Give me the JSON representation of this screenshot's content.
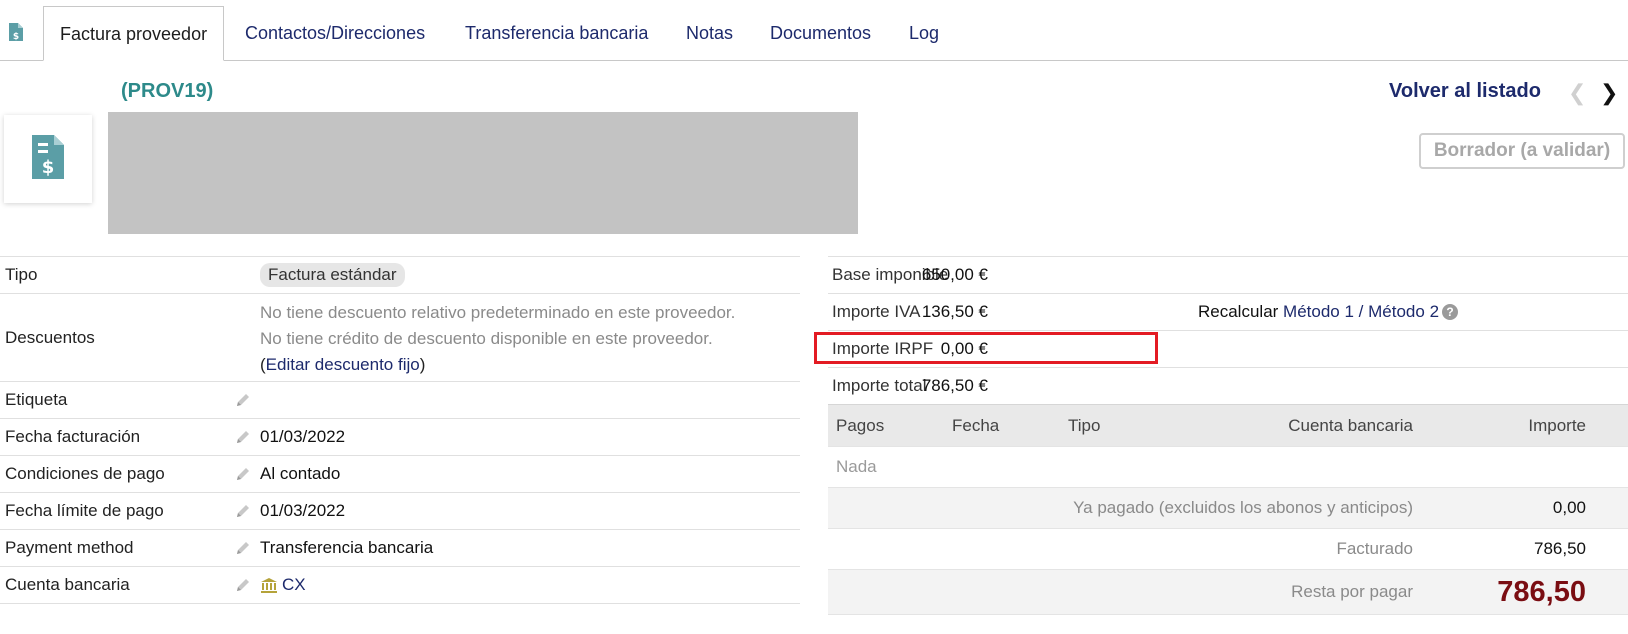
{
  "tabs": [
    {
      "label": "Factura proveedor",
      "active": true
    },
    {
      "label": "Contactos/Direcciones"
    },
    {
      "label": "Transferencia bancaria"
    },
    {
      "label": "Notas"
    },
    {
      "label": "Documentos"
    },
    {
      "label": "Log"
    }
  ],
  "header": {
    "ref": "(PROV19)",
    "back_label": "Volver al listado",
    "status": "Borrador (a validar)"
  },
  "fields": {
    "tipo": {
      "label": "Tipo",
      "value": "Factura estándar"
    },
    "descuentos": {
      "label": "Descuentos",
      "line1": "No tiene descuento relativo predeterminado en este proveedor.",
      "line2": "No tiene crédito de descuento disponible en este proveedor.",
      "open_paren": "(",
      "link": "Editar descuento fijo",
      "close_paren": ")"
    },
    "etiqueta": {
      "label": "Etiqueta",
      "value": ""
    },
    "fecha_facturacion": {
      "label": "Fecha facturación",
      "value": "01/03/2022"
    },
    "condiciones_pago": {
      "label": "Condiciones de pago",
      "value": "Al contado"
    },
    "fecha_limite": {
      "label": "Fecha límite de pago",
      "value": "01/03/2022"
    },
    "payment_method": {
      "label": "Payment method",
      "value": "Transferencia bancaria"
    },
    "cuenta_bancaria": {
      "label": "Cuenta bancaria",
      "value": "CX"
    }
  },
  "amounts": {
    "base": {
      "label": "Base imponible",
      "value": "650,00 €"
    },
    "iva": {
      "label": "Importe IVA",
      "value": "136,50 €"
    },
    "irpf": {
      "label": "Importe IRPF",
      "value": "0,00 €"
    },
    "total": {
      "label": "Importe total",
      "value": "786,50 €"
    },
    "recalc": {
      "label": "Recalcular",
      "method1": "Método 1",
      "sep": "/",
      "method2": "Método 2"
    }
  },
  "payments": {
    "headers": {
      "pagos": "Pagos",
      "fecha": "Fecha",
      "tipo": "Tipo",
      "cuenta": "Cuenta bancaria",
      "importe": "Importe"
    },
    "empty": "Nada",
    "ya_pagado": {
      "label": "Ya pagado (excluidos los abonos y anticipos)",
      "value": "0,00"
    },
    "facturado": {
      "label": "Facturado",
      "value": "786,50"
    },
    "resta": {
      "label": "Resta por pagar",
      "value": "786,50"
    }
  },
  "colors": {
    "accent": "#2d8a8a",
    "link": "#1d2a6c",
    "due": "#7a0d12",
    "highlight": "#e31b23"
  }
}
